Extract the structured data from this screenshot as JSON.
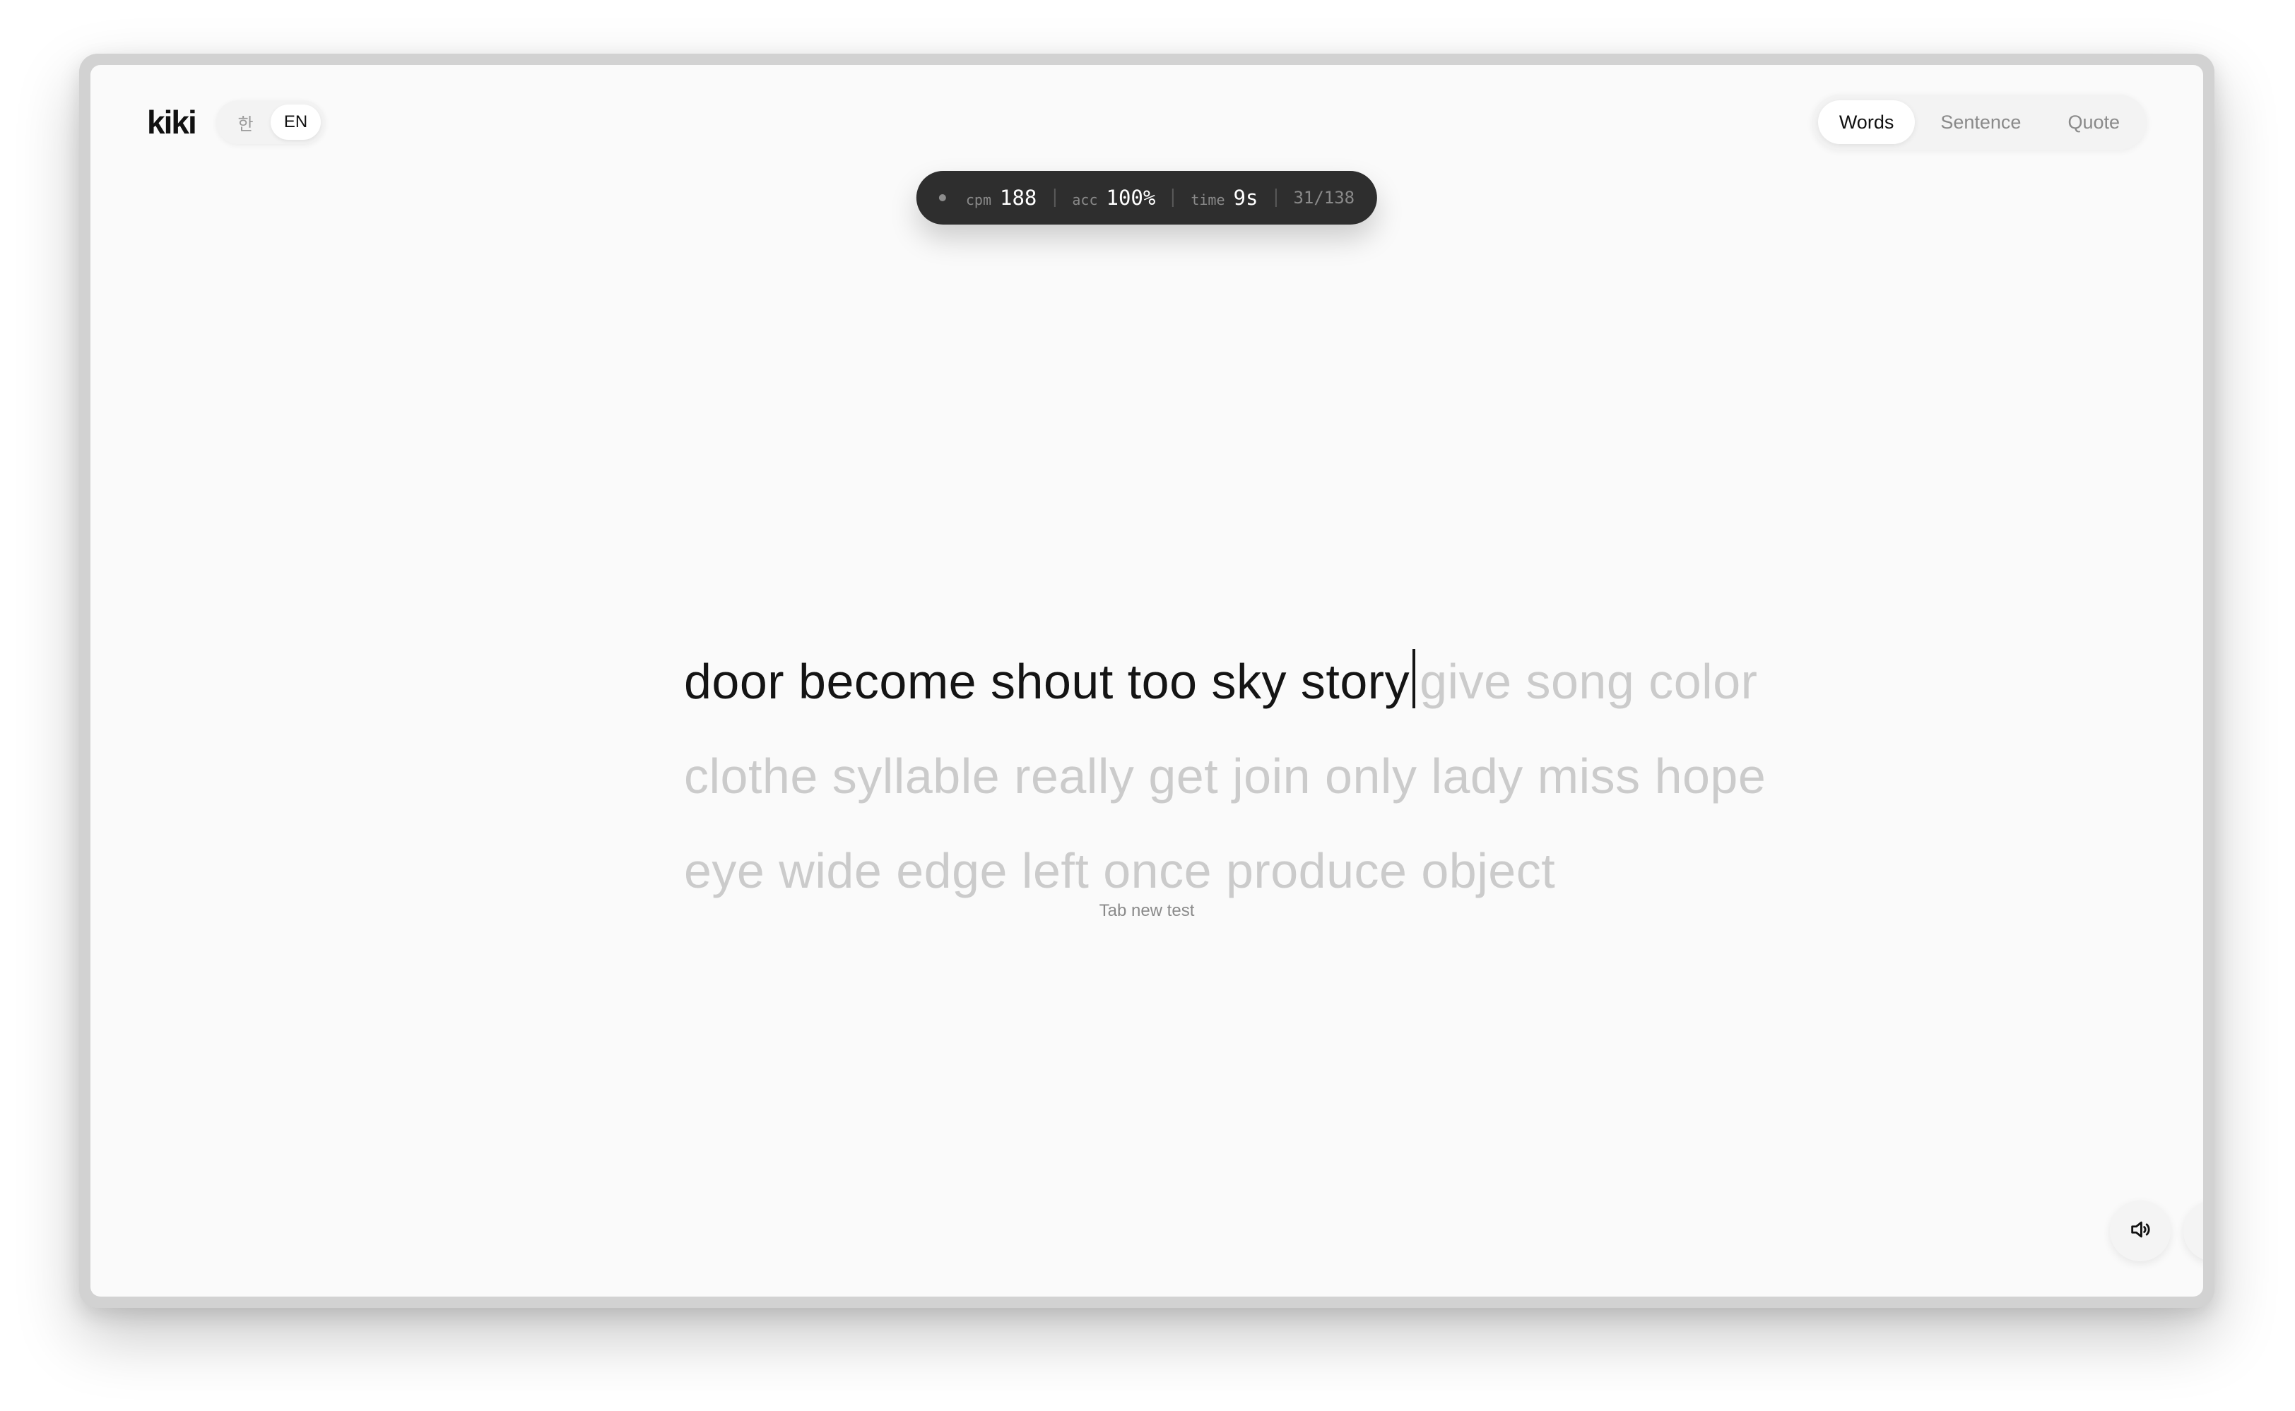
{
  "header": {
    "logo": "kiki",
    "languages": [
      {
        "label": "한",
        "active": false
      },
      {
        "label": "EN",
        "active": true
      }
    ],
    "modes": [
      {
        "label": "Words",
        "active": true
      },
      {
        "label": "Sentence",
        "active": false
      },
      {
        "label": "Quote",
        "active": false
      }
    ]
  },
  "stats": {
    "cpm_label": "cpm",
    "cpm_value": "188",
    "acc_label": "acc",
    "acc_value": "100%",
    "time_label": "time",
    "time_value": "9s",
    "progress": "31/138"
  },
  "typing": {
    "typed": "door become shout too sky story",
    "pending": "give song color clothe syllable really get join only lady miss hope eye wide edge left once produce object"
  },
  "hint": "Tab new test",
  "controls": {
    "sound_icon": "speaker-icon",
    "theme_icon": "moon-icon"
  }
}
